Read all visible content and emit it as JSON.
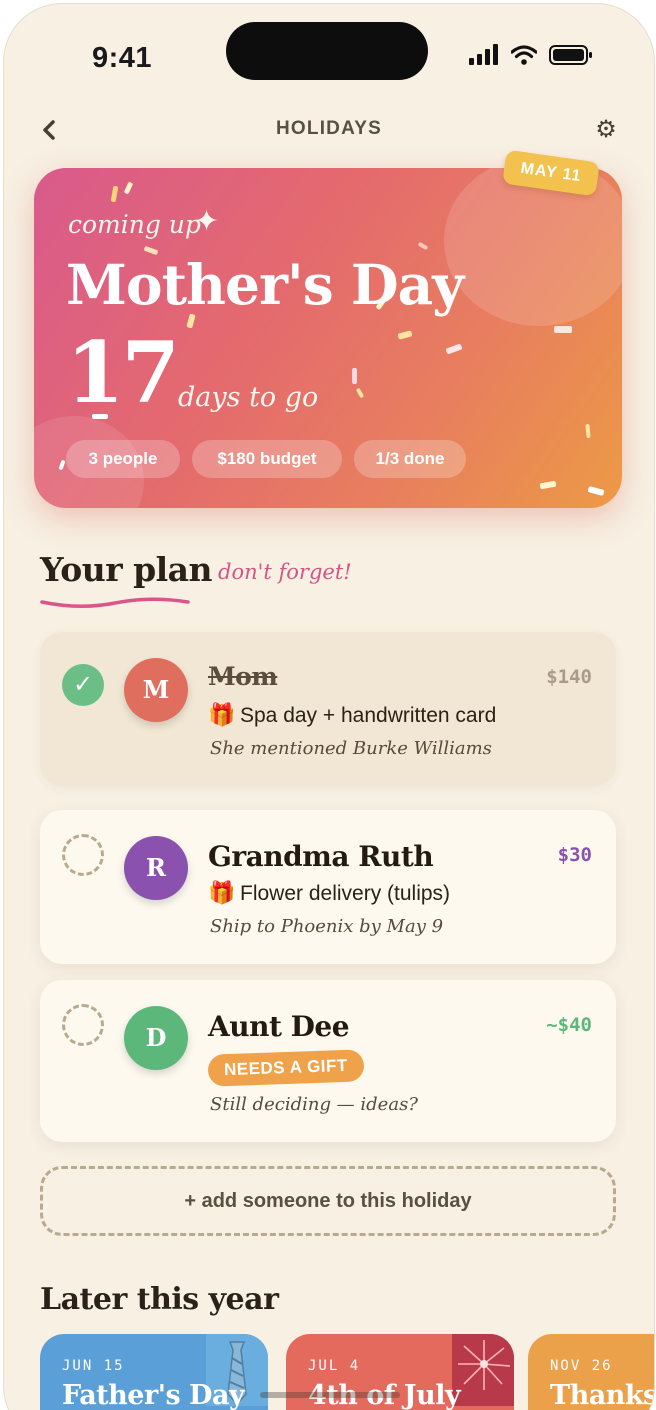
{
  "status": {
    "time": "9:41"
  },
  "nav": {
    "back_icon": "chevron-left-icon",
    "title": "HOLIDAYS",
    "settings_icon": "gear-icon"
  },
  "hero": {
    "kicker": "coming up",
    "title": "Mother's Day",
    "days": "17",
    "days_label": "days to go",
    "date_tag": "MAY 11",
    "chips": [
      "3 people",
      "$180 budget",
      "1/3 done"
    ],
    "colors": {
      "gradient_start": "#d95a8c",
      "gradient_end": "#ec9a46"
    }
  },
  "plan": {
    "heading": "Your plan",
    "note": "don't forget!",
    "people": [
      {
        "name": "Mom",
        "initial": "M",
        "done": true,
        "price": "$140",
        "gift": "Spa day + handwritten card",
        "note": "She mentioned Burke Williams",
        "avatar_color": "#e06e5e",
        "price_color": "#a89c88"
      },
      {
        "name": "Grandma Ruth",
        "initial": "R",
        "done": false,
        "price": "$30",
        "gift": "Flower delivery (tulips)",
        "note": "Ship to Phoenix by May 9",
        "avatar_color": "#8a52ae",
        "price_color": "#8a52ae"
      },
      {
        "name": "Aunt Dee",
        "initial": "D",
        "done": false,
        "price": "~$40",
        "badge": "NEEDS A GIFT",
        "note": "Still deciding — ideas?",
        "avatar_color": "#5cb87a",
        "price_color": "#5cb87a"
      }
    ],
    "add_label": "+ add someone to this holiday"
  },
  "later": {
    "heading": "Later this year",
    "holidays": [
      {
        "date": "JUN 15",
        "name": "Father's Day",
        "color": "#5b9fd8"
      },
      {
        "date": "JUL 4",
        "name": "4th of July",
        "color": "#e46a5e"
      },
      {
        "date": "NOV 26",
        "name": "Thanksgiving",
        "color": "#eba04a"
      }
    ]
  }
}
